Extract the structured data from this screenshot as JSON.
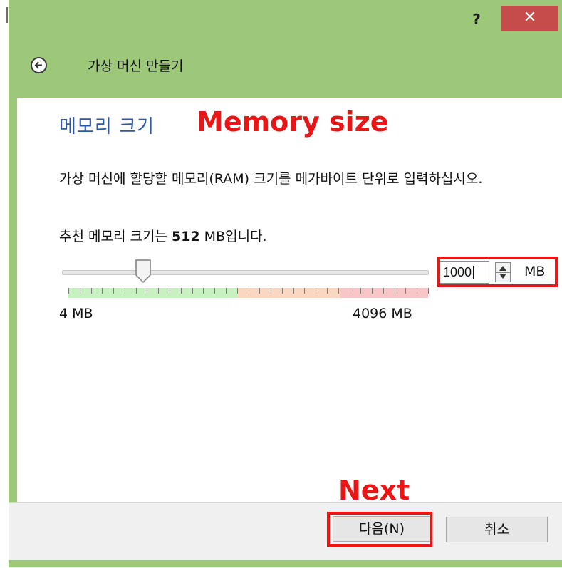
{
  "window": {
    "help_label": "?",
    "close_label": "✕",
    "title": "가상 머신 만들기"
  },
  "page": {
    "title": "메모리 크기",
    "description": "가상 머신에 할당할 메모리(RAM) 크기를 메가바이트 단위로 입력하십시오.",
    "recommend_prefix": "추천 메모리 크기는 ",
    "recommend_value": "512",
    "recommend_suffix": " MB입니다."
  },
  "memory": {
    "value": "1000",
    "unit": "MB",
    "min_label": "4 MB",
    "max_label": "4096 MB",
    "min": 4,
    "max": 4096,
    "slider_value": 1000
  },
  "annotations": {
    "memory_size": "Memory size",
    "next": "Next",
    "color": "#ea1515"
  },
  "buttons": {
    "next_label": "다음(N)",
    "cancel_label": "취소"
  },
  "colors": {
    "frame": "#9dc87a",
    "close_button": "#c64b4b",
    "title_blue": "#2c58a6",
    "scale_green": "#c9f0c2",
    "scale_orange": "#f9d7c2",
    "scale_red": "#f7c6c6"
  },
  "icons": {
    "back": "back-arrow-icon",
    "spin_up": "chevron-up-icon",
    "spin_down": "chevron-down-icon"
  }
}
